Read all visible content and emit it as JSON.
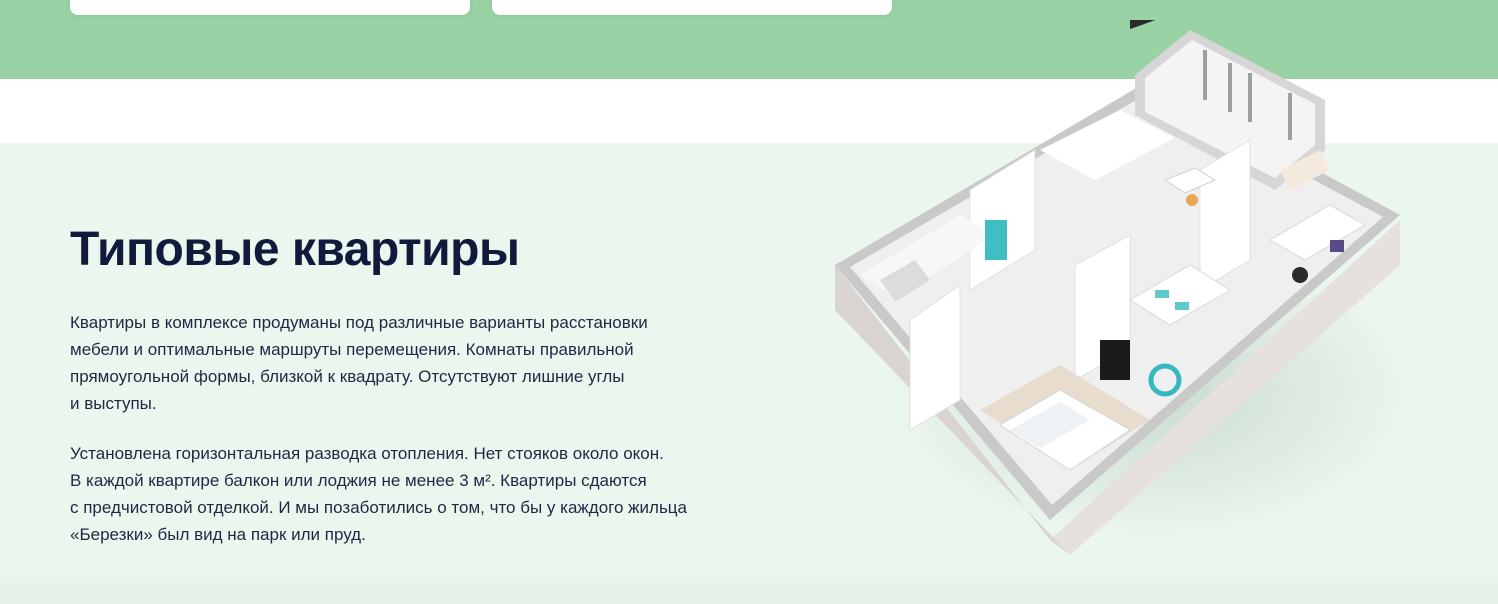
{
  "section": {
    "title": "Типовые квартиры",
    "paragraph1": [
      "Квартиры в комплексе продуманы под различные варианты расстановки",
      "мебели и оптимальные маршруты перемещения. Комнаты правильной",
      "прямоугольной формы, близкой к квадрату. Отсутствуют лишние углы",
      "и выступы."
    ],
    "paragraph2": [
      "Установлена горизонтальная разводка отопления. Нет стояков около окон.",
      "В каждой квартире балкон или лоджия не менее 3 м². Квартиры сдаются",
      "с предчистовой отделкой. И мы позаботились о том, что бы у каждого жильца",
      "«Березки» был вид на парк или пруд."
    ]
  },
  "colors": {
    "top_band": "#99d3a5",
    "section_bg": "#ebf6ee",
    "title": "#101a3a",
    "text": "#1e2843"
  },
  "image": {
    "icon": "apartment-3d-floorplan"
  }
}
